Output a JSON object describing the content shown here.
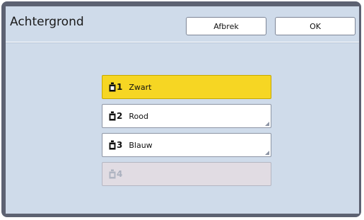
{
  "header": {
    "title": "Achtergrond",
    "cancel_label": "Afbrek",
    "ok_label": "OK"
  },
  "drums": [
    {
      "number": "1",
      "label": "Zwart",
      "state": "selected",
      "icon": "ink-bottle-icon"
    },
    {
      "number": "2",
      "label": "Rood",
      "state": "normal",
      "icon": "ink-bottle-icon"
    },
    {
      "number": "3",
      "label": "Blauw",
      "state": "normal",
      "icon": "ink-bottle-icon"
    },
    {
      "number": "4",
      "label": "",
      "state": "disabled",
      "icon": "ink-bottle-icon"
    }
  ],
  "colors": {
    "panel_bg": "#cfdbea",
    "selected": "#f6d623",
    "disabled": "#e1dce3"
  }
}
